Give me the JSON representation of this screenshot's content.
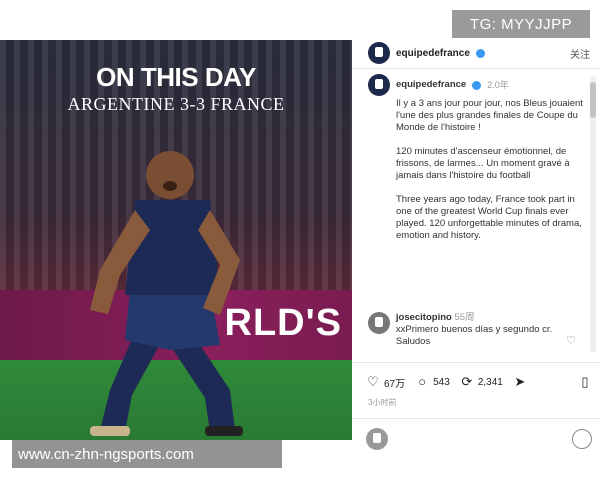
{
  "watermarks": {
    "top": "TG: MYYJJPP",
    "bottom": "www.cn-zhn-ngsports.com"
  },
  "photo": {
    "headline": "ON THIS DAY",
    "subheadline": "ARGENTINE 3-3 FRANCE",
    "banner_text": "RLD'S",
    "colors": {
      "banner": "#8a1f5c",
      "pitch": "#2f8a3a",
      "kit": "#1c2a55"
    }
  },
  "post": {
    "account": "equipedefrance",
    "more_label": "关注",
    "caption_header": {
      "account": "equipedefrance",
      "time": "2.0年"
    },
    "caption_paragraphs": [
      "Il y a 3 ans jour pour jour, nos Bleus jouaient l'une des plus grandes finales de Coupe du Monde de l'histoire !",
      "120 minutes d'ascenseur émotionnel, de frissons, de larmes... Un moment gravé à jamais dans l'histoire du football",
      "Three years ago today, France took part in one of the greatest World Cup finals ever played. 120 unforgettable minutes of drama, emotion and history."
    ],
    "comment": {
      "user": "josecitopino",
      "time": "55周",
      "text": "xxPrimero buenos días y segundo cr. Saludos"
    },
    "actions": {
      "likes": "67万",
      "comments": "543",
      "reposts": "2,341"
    },
    "date": "3小时前",
    "icons": [
      "heart-icon",
      "comment-icon",
      "repost-icon",
      "send-icon",
      "bookmark-icon",
      "more-icon"
    ]
  }
}
